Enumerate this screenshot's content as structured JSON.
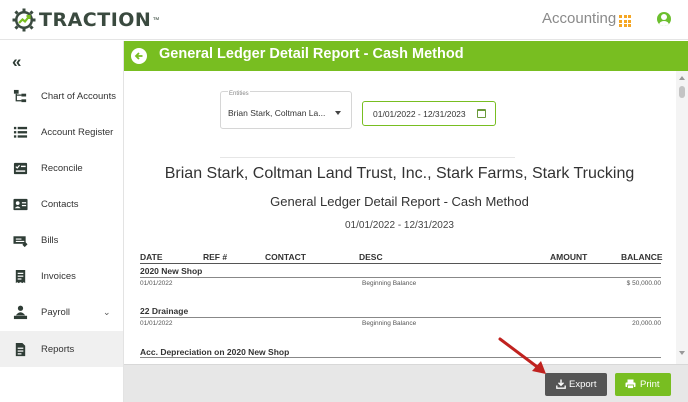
{
  "header": {
    "logo_text": "TRACTION",
    "logo_tm": "™",
    "app_name": "Accounting",
    "apps_icon": "grid-icon",
    "user_icon": "user-icon",
    "accent_color": "#78be21",
    "apps_icon_color": "#f5a623"
  },
  "sidebar": {
    "collapse_icon": "double-chevron-left-icon",
    "items": [
      {
        "label": "Chart of Accounts",
        "icon": "hierarchy-icon"
      },
      {
        "label": "Account Register",
        "icon": "list-icon"
      },
      {
        "label": "Reconcile",
        "icon": "reconcile-icon"
      },
      {
        "label": "Contacts",
        "icon": "contact-card-icon"
      },
      {
        "label": "Bills",
        "icon": "money-icon"
      },
      {
        "label": "Invoices",
        "icon": "receipt-icon"
      },
      {
        "label": "Payroll",
        "icon": "person-money-icon",
        "has_submenu": true,
        "chevron": "⌄"
      },
      {
        "label": "Reports",
        "icon": "document-icon",
        "active": true
      }
    ]
  },
  "page": {
    "title": "General Ledger Detail Report - Cash Method"
  },
  "filters": {
    "entities_label": "Entities",
    "entities_value": "Brian Stark, Coltman La...",
    "date_range": "01/01/2022 - 12/31/2023"
  },
  "report": {
    "company": "Brian Stark, Coltman Land Trust, Inc., Stark Farms, Stark Trucking",
    "name": "General Ledger Detail Report - Cash Method",
    "dates": "01/01/2022 - 12/31/2023",
    "columns": {
      "date": "DATE",
      "ref": "REF #",
      "contact": "CONTACT",
      "desc": "DESC",
      "amount": "AMOUNT",
      "balance": "BALANCE"
    },
    "groups": [
      {
        "title": "2020 New Shop",
        "rows": [
          {
            "date": "01/01/2022",
            "desc": "Beginning Balance",
            "balance": "$ 50,000.00"
          }
        ]
      },
      {
        "title": "22 Drainage",
        "rows": [
          {
            "date": "01/01/2022",
            "desc": "Beginning Balance",
            "balance": "20,000.00"
          }
        ]
      },
      {
        "title": "Acc. Depreciation on 2020 New Shop",
        "rows": []
      }
    ]
  },
  "footer": {
    "export_label": "Export",
    "print_label": "Print"
  }
}
